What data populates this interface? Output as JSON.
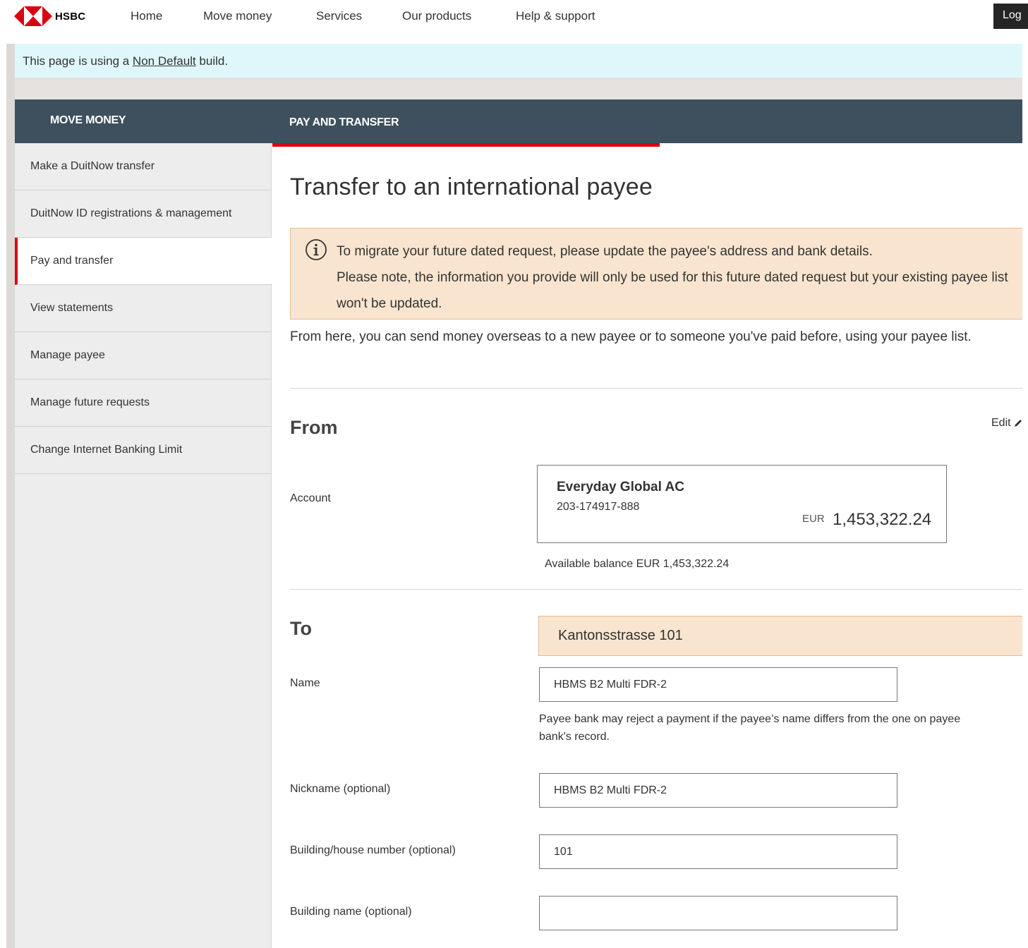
{
  "brand": {
    "name": "HSBC",
    "logo_colors": {
      "red": "#db0011",
      "white": "#ffffff"
    }
  },
  "nav": {
    "items": [
      "Home",
      "Move money",
      "Services",
      "Our products",
      "Help & support"
    ],
    "login_label": "Log"
  },
  "banner": {
    "prefix": "This page is using a ",
    "link": "Non Default",
    "suffix": " build."
  },
  "header": {
    "sidebar_title": "MOVE MONEY",
    "main_title": "PAY AND TRANSFER"
  },
  "sidebar": {
    "items": [
      {
        "label": "Make a DuitNow transfer",
        "active": false
      },
      {
        "label": "DuitNow ID registrations & management",
        "active": false
      },
      {
        "label": "Pay and transfer",
        "active": true
      },
      {
        "label": "View statements",
        "active": false
      },
      {
        "label": "Manage payee",
        "active": false
      },
      {
        "label": "Manage future requests",
        "active": false
      },
      {
        "label": "Change Internet Banking Limit",
        "active": false
      }
    ]
  },
  "main": {
    "title": "Transfer to an international payee",
    "notice": {
      "line1": "To migrate your future dated request, please update the payee's address and bank details.",
      "line2": "Please note, the information you provide will only be used for this future dated request but your existing payee list won't be updated."
    },
    "intro": "From here, you can send money overseas to a new payee or to someone you've paid before, using your payee list.",
    "from": {
      "heading": "From",
      "edit_label": "Edit",
      "account_label": "Account",
      "account": {
        "name": "Everyday Global AC",
        "number": "203-174917-888",
        "currency": "EUR",
        "amount": "1,453,322.24"
      },
      "available_balance": "Available balance EUR 1,453,322.24"
    },
    "to": {
      "heading": "To",
      "address_banner": "Kantonsstrasse 101",
      "fields": {
        "name": {
          "label": "Name",
          "value": "HBMS B2 Multi FDR-2"
        },
        "name_hint": "Payee bank may reject a payment if the payee’s name differs from the one on payee bank's record.",
        "nickname": {
          "label": "Nickname (optional)",
          "value": "HBMS B2 Multi FDR-2"
        },
        "building_number": {
          "label": "Building/house number (optional)",
          "value": "101"
        },
        "building_name": {
          "label": "Building name (optional)",
          "value": ""
        }
      }
    }
  },
  "colors": {
    "accent_red": "#db0011",
    "header_dark": "#3e505d",
    "notice_bg": "#f9e5cf",
    "banner_bg": "#dff7fb",
    "sidebar_bg": "#ededed"
  }
}
